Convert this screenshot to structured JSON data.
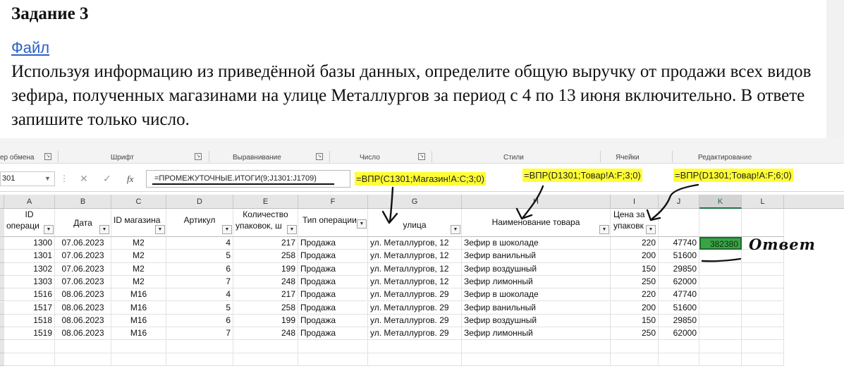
{
  "task": {
    "title": "Задание 3",
    "file_link": "Файл",
    "text": "Используя информацию из приведённой базы данных, определите общую выручку от продажи всех видов зефира, полученных магазинами на улице Металлургов за период с 4 по 13 июня включительно. В ответе запишите только число."
  },
  "ribbon": {
    "groups": [
      "ер обмена",
      "Шрифт",
      "Выравнивание",
      "Число",
      "Стили",
      "Ячейки",
      "Редактирование"
    ]
  },
  "formula_bar": {
    "name_box": "301",
    "cancel": "✕",
    "enter": "✓",
    "fx": "fx",
    "formula": "=ПРОМЕЖУТОЧНЫЕ.ИТОГИ(9;J1301:J1709)"
  },
  "annotations": {
    "note_g": "=ВПР(C1301;Магазин!A:C;3;0)",
    "note_h": "=ВПР(D1301;Товар!A:F;3;0)",
    "note_i": "=ВПР(D1301;Товар!A:F;6;0)",
    "answer_note": "Ответ"
  },
  "columns": [
    "A",
    "B",
    "C",
    "D",
    "E",
    "F",
    "G",
    "H",
    "I",
    "J",
    "K",
    "L"
  ],
  "headers": {
    "A": [
      "ID",
      "операци"
    ],
    "B": "Дата",
    "C": "ID магазина",
    "D": "Артикул",
    "E": [
      "Количество",
      "упаковок, ш"
    ],
    "F": "Тип операции",
    "G": "улица",
    "H": "Наименование товара",
    "I": [
      "Цена за",
      "упаковк"
    ]
  },
  "rows": [
    {
      "id": "1300",
      "date": "07.06.2023",
      "shop": "М2",
      "art": "4",
      "qty": "217",
      "op": "Продажа",
      "street": "ул. Металлургов, 12",
      "name": "Зефир в шоколаде",
      "price": "220",
      "sum": "47740",
      "k": "382380"
    },
    {
      "id": "1301",
      "date": "07.06.2023",
      "shop": "М2",
      "art": "5",
      "qty": "258",
      "op": "Продажа",
      "street": "ул. Металлургов, 12",
      "name": "Зефир ванильный",
      "price": "200",
      "sum": "51600",
      "k": ""
    },
    {
      "id": "1302",
      "date": "07.06.2023",
      "shop": "М2",
      "art": "6",
      "qty": "199",
      "op": "Продажа",
      "street": "ул. Металлургов, 12",
      "name": "Зефир воздушный",
      "price": "150",
      "sum": "29850",
      "k": ""
    },
    {
      "id": "1303",
      "date": "07.06.2023",
      "shop": "М2",
      "art": "7",
      "qty": "248",
      "op": "Продажа",
      "street": "ул. Металлургов, 12",
      "name": "Зефир лимонный",
      "price": "250",
      "sum": "62000",
      "k": ""
    },
    {
      "id": "1516",
      "date": "08.06.2023",
      "shop": "М16",
      "art": "4",
      "qty": "217",
      "op": "Продажа",
      "street": "ул. Металлургов. 29",
      "name": "Зефир в шоколаде",
      "price": "220",
      "sum": "47740",
      "k": ""
    },
    {
      "id": "1517",
      "date": "08.06.2023",
      "shop": "М16",
      "art": "5",
      "qty": "258",
      "op": "Продажа",
      "street": "ул. Металлургов. 29",
      "name": "Зефир ванильный",
      "price": "200",
      "sum": "51600",
      "k": ""
    },
    {
      "id": "1518",
      "date": "08.06.2023",
      "shop": "М16",
      "art": "6",
      "qty": "199",
      "op": "Продажа",
      "street": "ул. Металлургов. 29",
      "name": "Зефир воздушный",
      "price": "150",
      "sum": "29850",
      "k": ""
    },
    {
      "id": "1519",
      "date": "08.06.2023",
      "shop": "М16",
      "art": "7",
      "qty": "248",
      "op": "Продажа",
      "street": "ул. Металлургов. 29",
      "name": "Зефир лимонный",
      "price": "250",
      "sum": "62000",
      "k": ""
    }
  ],
  "colors": {
    "highlight": "#ffff33",
    "answer_fill": "#3aa346",
    "link": "#2a60c8",
    "selected_col": "#217346"
  },
  "icons": [
    "filter-icon",
    "dropdown-icon",
    "launcher-icon"
  ]
}
